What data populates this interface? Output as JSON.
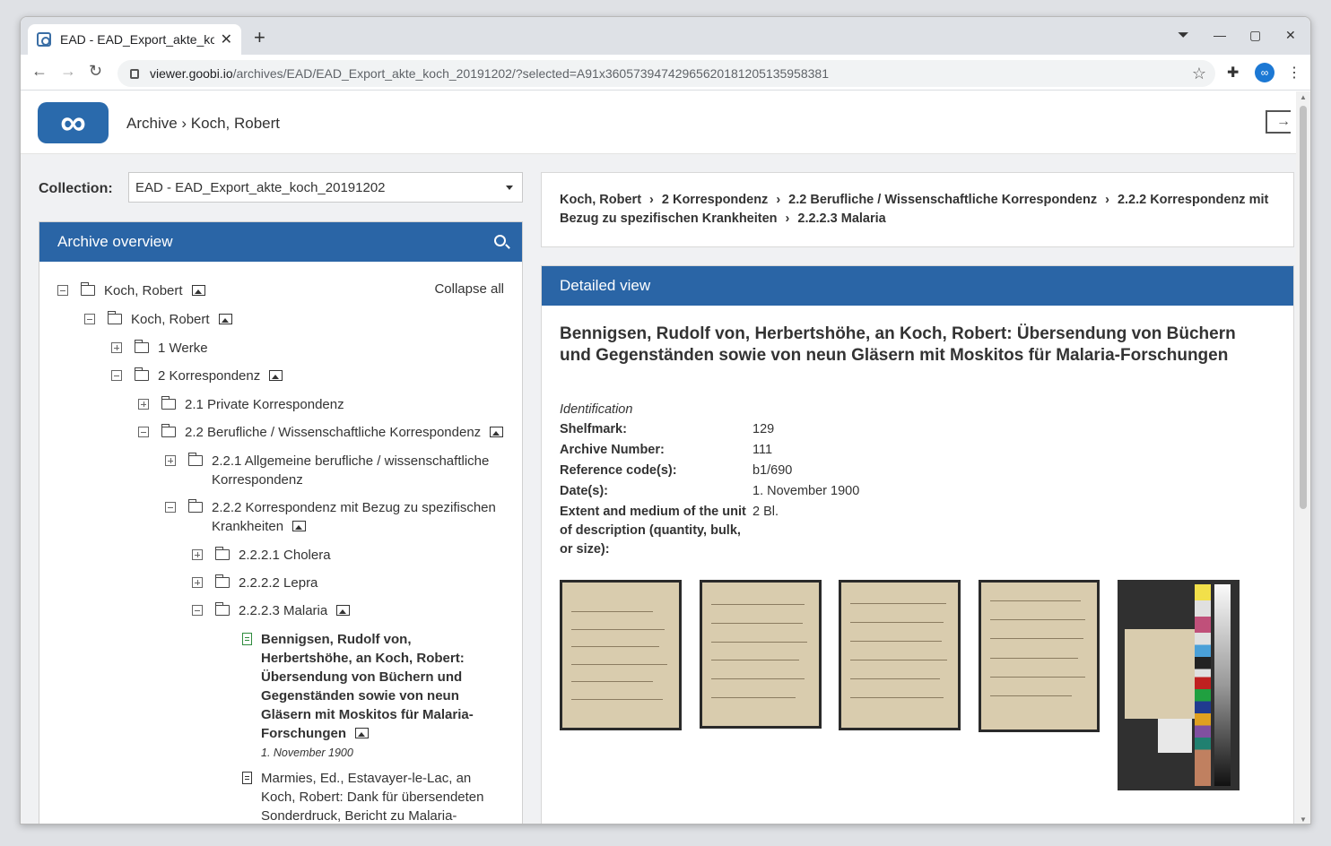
{
  "browser": {
    "tab_title": "EAD - EAD_Export_akte_koch",
    "url_host": "viewer.goobi.io",
    "url_path": "/archives/EAD/EAD_Export_akte_koch_20191202/?selected=A91x36057394742965620181205135958381"
  },
  "header": {
    "breadcrumb": "Archive › Koch, Robert"
  },
  "collection": {
    "label": "Collection:",
    "value": "EAD - EAD_Export_akte_koch_20191202"
  },
  "overview": {
    "title": "Archive overview",
    "collapse_all": "Collapse all",
    "nodes": [
      {
        "label": "Koch, Robert"
      },
      {
        "label": "Koch, Robert"
      },
      {
        "label": "1 Werke"
      },
      {
        "label": "2 Korrespondenz"
      },
      {
        "label": "2.1 Private Korrespondenz"
      },
      {
        "label": "2.2 Berufliche / Wissenschaftliche Korrespondenz"
      },
      {
        "label": "2.2.1 Allgemeine berufliche / wissenschaftliche Korrespondenz"
      },
      {
        "label": "2.2.2 Korrespondenz mit Bezug zu spezifischen Krankheiten"
      },
      {
        "label": "2.2.2.1 Cholera"
      },
      {
        "label": "2.2.2.2 Lepra"
      },
      {
        "label": "2.2.2.3 Malaria"
      }
    ],
    "selected_item": {
      "label": "Bennigsen, Rudolf von, Herbertshöhe, an Koch, Robert: Übersendung von Büchern und Gegenständen sowie von neun Gläsern mit Moskitos für Malaria-Forschungen",
      "date": "1. November 1900"
    },
    "next_item": {
      "label": "Marmies, Ed., Estavayer-le-Lac, an Koch, Robert: Dank für übersendeten Sonderdruck, Bericht zu Malaria-"
    }
  },
  "path": {
    "items": [
      "Koch, Robert",
      "2 Korrespondenz",
      "2.2 Berufliche / Wissenschaftliche Korrespondenz",
      "2.2.2 Korrespondenz mit Bezug zu spezifischen Krankheiten",
      "2.2.2.3 Malaria"
    ],
    "separator": "›"
  },
  "detail": {
    "title": "Detailed view",
    "heading": "Bennigsen, Rudolf von, Herbertshöhe, an Koch, Robert: Übersendung von Büchern und Gegenständen sowie von neun Gläsern mit Moskitos für Malaria-Forschungen",
    "section": "Identification",
    "fields": [
      {
        "key": "Shelfmark:",
        "value": "129"
      },
      {
        "key": "Archive Number:",
        "value": "111"
      },
      {
        "key": "Reference code(s):",
        "value": "b1/690"
      },
      {
        "key": "Date(s):",
        "value": "1. November 1900"
      },
      {
        "key": "Extent and medium of the unit of description (quantity, bulk, or size):",
        "value": "2 Bl."
      }
    ]
  },
  "colors": {
    "primary": "#2a65a6",
    "selected_doc": "#2e8b3d"
  }
}
